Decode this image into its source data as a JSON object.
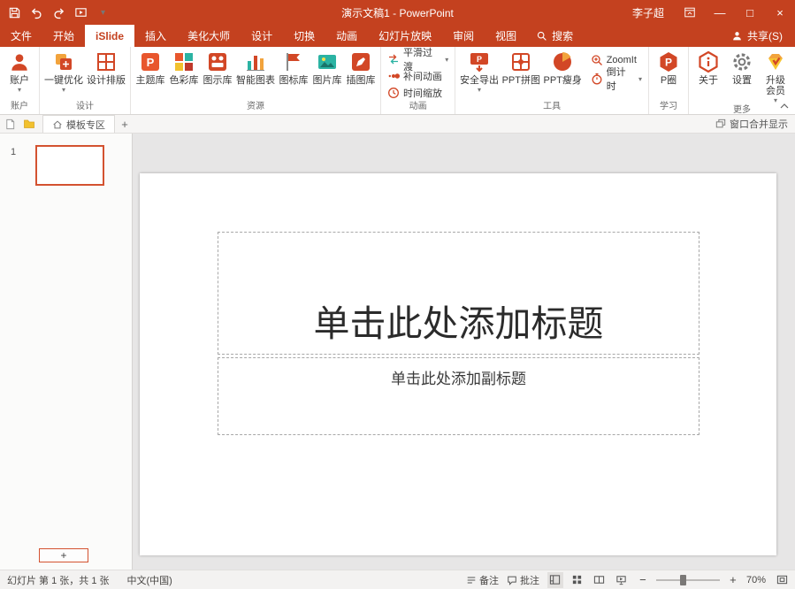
{
  "colors": {
    "titlebar_red": "#C4411F",
    "accent_red": "#D24726",
    "selection_orange": "#D35230"
  },
  "titlebar": {
    "title": "演示文稿1 - PowerPoint",
    "user": "李子超",
    "minimize": "—",
    "maximize": "□",
    "close": "×"
  },
  "tabs": {
    "items": [
      {
        "label": "文件"
      },
      {
        "label": "开始"
      },
      {
        "label": "iSlide"
      },
      {
        "label": "插入"
      },
      {
        "label": "美化大师"
      },
      {
        "label": "设计"
      },
      {
        "label": "切换"
      },
      {
        "label": "动画"
      },
      {
        "label": "幻灯片放映"
      },
      {
        "label": "审阅"
      },
      {
        "label": "视图"
      }
    ],
    "search_label": "搜索",
    "share_label": "共享(S)"
  },
  "ribbon": {
    "account": {
      "label": "账户",
      "button": "账户"
    },
    "design": {
      "label": "设计",
      "optimize": "一键优化",
      "layout": "设计排版"
    },
    "resources": {
      "label": "资源",
      "theme": "主题库",
      "color": "色彩库",
      "diagram": "图示库",
      "smart_chart": "智能图表",
      "icon": "图标库",
      "picture": "图片库",
      "illustration": "插图库"
    },
    "animation": {
      "label": "动画",
      "smooth": "平滑过渡",
      "tween": "补间动画",
      "timeline": "时间缩放"
    },
    "tools": {
      "label": "工具",
      "export": "安全导出",
      "puzzle": "PPT拼图",
      "slim": "PPT瘦身",
      "zoomit": "ZoomIt",
      "countdown": "倒计时"
    },
    "learning": {
      "label": "学习",
      "pq": "P圈"
    },
    "more": {
      "label": "更多",
      "about": "关于",
      "settings": "设置",
      "upgrade": "升级会员"
    }
  },
  "doctabbar": {
    "tab_label": "模板专区",
    "merge_label": "窗口合并显示"
  },
  "slide_panel": {
    "slide_number": "1",
    "add_label": "+"
  },
  "slide": {
    "title_placeholder": "单击此处添加标题",
    "subtitle_placeholder": "单击此处添加副标题"
  },
  "statusbar": {
    "slide_info": "幻灯片 第 1 张，共 1 张",
    "language": "中文(中国)",
    "notes": "备注",
    "comments": "批注",
    "zoom_level": "70%"
  },
  "icons": {
    "caret_down": "▾",
    "plus": "+",
    "zoom_out": "−",
    "zoom_in": "+"
  }
}
